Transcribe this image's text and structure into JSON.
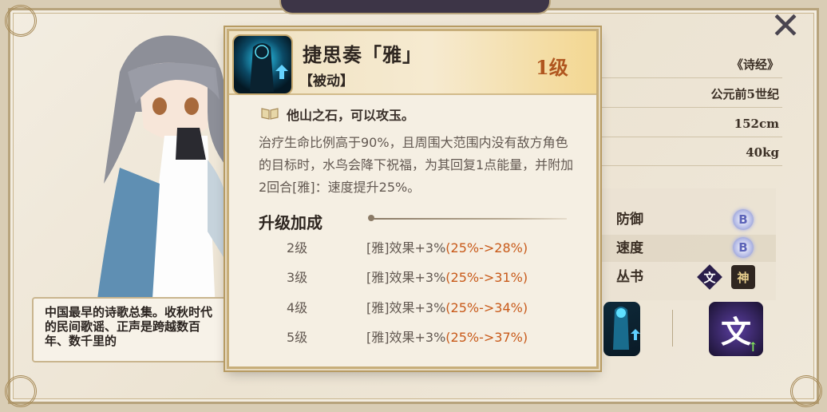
{
  "info": {
    "source": "《诗经》",
    "era": "公元前5世纪",
    "height": "152cm",
    "weight": "40kg"
  },
  "stats": [
    {
      "label": "防御",
      "grade": "B"
    },
    {
      "label": "速度",
      "grade": "B"
    },
    {
      "label": "丛书",
      "icons": [
        "文",
        "神"
      ]
    }
  ],
  "description": "中国最早的诗歌总集。收秋时代的民间歌谣、正声是跨越数百年、数千里的",
  "skill": {
    "name": "捷思奏「雅」",
    "type": "【被动】",
    "level": "1级",
    "quote": "他山之石，可以攻玉。",
    "effect": "治疗生命比例高于90%，且周围大范围内没有敌方角色的目标时，水鸟会降下祝福，为其回复1点能量，并附加2回合[雅]：速度提升25%。",
    "upgrade_title": "升级加成",
    "upgrades": [
      {
        "level": "2级",
        "effect": "[雅]效果+3%",
        "change": "(25%->28%)"
      },
      {
        "level": "3级",
        "effect": "[雅]效果+3%",
        "change": "(25%->31%)"
      },
      {
        "level": "4级",
        "effect": "[雅]效果+3%",
        "change": "(25%->34%)"
      },
      {
        "level": "5级",
        "effect": "[雅]效果+3%",
        "change": "(25%->37%)"
      }
    ]
  },
  "skill_thumb_big_label": "文",
  "colors": {
    "level": "#b0561f",
    "highlight": "#c85a1a",
    "grade": "#5b63b8"
  }
}
